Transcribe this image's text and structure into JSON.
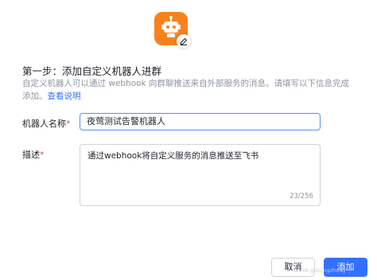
{
  "bot": {
    "avatar_icon": "robot-icon",
    "edit_icon": "edit-pencil-icon",
    "accent_color": "#f7821b"
  },
  "step": {
    "title": "第一步：添加自定义机器人进群",
    "description_line1": "自定义机器人可以通过 webhook 向群聊推送来自外部服务的消息。请填写以下信息完成",
    "description_line2": "添加。",
    "help_link": "查看说明"
  },
  "form": {
    "name_label": "机器人名称",
    "name_required": "*",
    "name_value": "夜莺测试告警机器人",
    "desc_label": "描述",
    "desc_required": "*",
    "desc_value": "通过webhook将自定义服务的消息推送至飞书",
    "desc_count": "23/256"
  },
  "actions": {
    "cancel_label": "取消",
    "add_label": "添加",
    "primary_color": "#3370ff"
  },
  "watermark": "CSDN @Xiangzhong"
}
